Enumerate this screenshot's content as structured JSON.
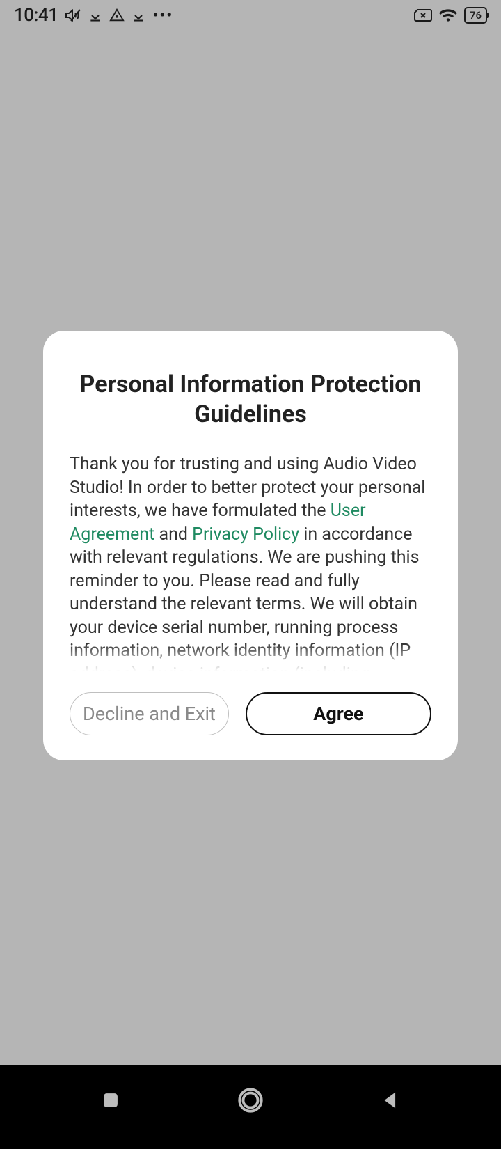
{
  "status_bar": {
    "time": "10:41",
    "battery_percent": "76"
  },
  "dialog": {
    "title": "Personal Information Protection Guidelines",
    "body_pre": "Thank you for trusting and using Audio Video Studio! In order to better protect your personal interests, we have formulated the ",
    "link_user_agreement": "User Agreement",
    "body_and": " and ",
    "link_privacy_policy": "Privacy Policy",
    "body_post": " in accordance with relevant regulations. We are pushing this reminder to you. Please read and fully understand the relevant terms. We will obtain your device serial number, running process information, network identity information (IP address), device information (including hardware model, device MAC address, operating system type, software list, unique",
    "decline_label": "Decline and Exit",
    "agree_label": "Agree"
  }
}
